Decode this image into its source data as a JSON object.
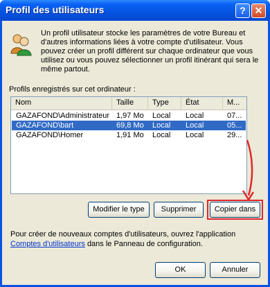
{
  "window": {
    "title": "Profil des utilisateurs",
    "help_label": "?",
    "close_label": "✕"
  },
  "intro": {
    "text": "Un profil utilisateur stocke les paramètres de votre Bureau et d'autres informations liées à votre compte d'utilisateur. Vous pouvez créer un profil différent sur chaque ordinateur que vous utilisez ou vous pouvez sélectionner un profil itinérant qui sera le même partout."
  },
  "profiles": {
    "label": "Profils enregistrés sur cet ordinateur :",
    "columns": [
      "Nom",
      "Taille",
      "Type",
      "État",
      "M..."
    ],
    "rows": [
      {
        "name": "GAZAFOND\\Administrateur",
        "size": "1,97 Mo",
        "type": "Local",
        "state": "Local",
        "modified": "07..."
      },
      {
        "name": "GAZAFOND\\bart",
        "size": "69,8 Mo",
        "type": "Local",
        "state": "Local",
        "modified": "05..."
      },
      {
        "name": "GAZAFOND\\Homer",
        "size": "1,91 Mo",
        "type": "Local",
        "state": "Local",
        "modified": "29..."
      }
    ],
    "selected_row": 1
  },
  "buttons": {
    "change_type": "Modifier le type",
    "delete": "Supprimer",
    "copy_to": "Copier dans",
    "ok": "OK",
    "cancel": "Annuler"
  },
  "footer": {
    "text_before": "Pour créer de nouveaux comptes d'utilisateurs, ouvrez l'application",
    "link": "Comptes d'utilisateurs",
    "text_after": "dans le Panneau de configuration."
  },
  "colors": {
    "title_bar": "#0553e0",
    "selection": "#316ac5",
    "highlight_box": "#e0262a",
    "link": "#0033cc"
  }
}
